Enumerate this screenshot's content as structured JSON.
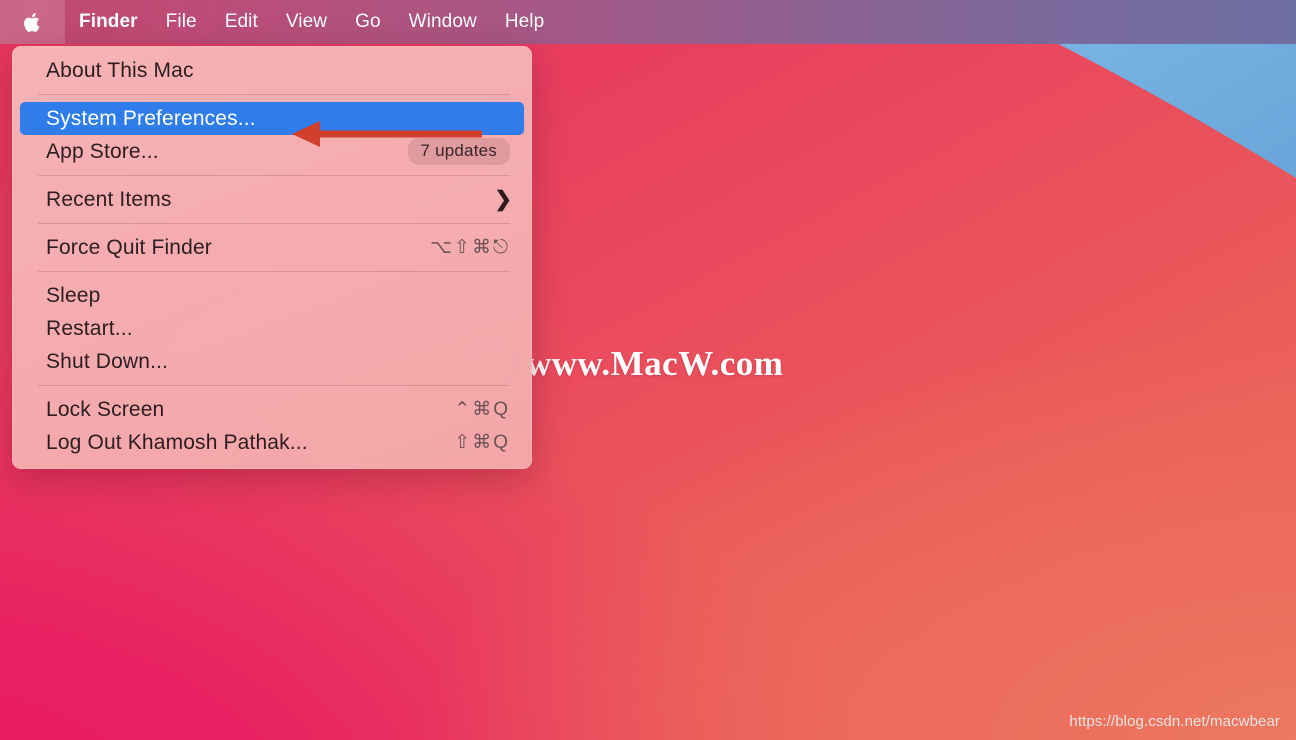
{
  "menubar": {
    "apple_icon": "apple-logo-icon",
    "items": [
      {
        "label": "Finder",
        "bold": true
      },
      {
        "label": "File",
        "bold": false
      },
      {
        "label": "Edit",
        "bold": false
      },
      {
        "label": "View",
        "bold": false
      },
      {
        "label": "Go",
        "bold": false
      },
      {
        "label": "Window",
        "bold": false
      },
      {
        "label": "Help",
        "bold": false
      }
    ]
  },
  "apple_menu": {
    "groups": [
      {
        "rows": [
          {
            "name": "about-this-mac",
            "label": "About This Mac",
            "shortcut": "",
            "badge": "",
            "submenu": false,
            "highlighted": false
          }
        ]
      },
      {
        "rows": [
          {
            "name": "system-preferences",
            "label": "System Preferences...",
            "shortcut": "",
            "badge": "",
            "submenu": false,
            "highlighted": true
          },
          {
            "name": "app-store",
            "label": "App Store...",
            "shortcut": "",
            "badge": "7 updates",
            "submenu": false,
            "highlighted": false
          }
        ]
      },
      {
        "rows": [
          {
            "name": "recent-items",
            "label": "Recent Items",
            "shortcut": "",
            "badge": "",
            "submenu": true,
            "highlighted": false
          }
        ]
      },
      {
        "rows": [
          {
            "name": "force-quit-finder",
            "label": "Force Quit Finder",
            "shortcut": "⌥⇧⌘⎋",
            "badge": "",
            "submenu": false,
            "highlighted": false
          }
        ]
      },
      {
        "rows": [
          {
            "name": "sleep",
            "label": "Sleep",
            "shortcut": "",
            "badge": "",
            "submenu": false,
            "highlighted": false
          },
          {
            "name": "restart",
            "label": "Restart...",
            "shortcut": "",
            "badge": "",
            "submenu": false,
            "highlighted": false
          },
          {
            "name": "shut-down",
            "label": "Shut Down...",
            "shortcut": "",
            "badge": "",
            "submenu": false,
            "highlighted": false
          }
        ]
      },
      {
        "rows": [
          {
            "name": "lock-screen",
            "label": "Lock Screen",
            "shortcut": "⌃⌘Q",
            "badge": "",
            "submenu": false,
            "highlighted": false
          },
          {
            "name": "log-out",
            "label": "Log Out Khamosh Pathak...",
            "shortcut": "⇧⌘Q",
            "badge": "",
            "submenu": false,
            "highlighted": false
          }
        ]
      }
    ]
  },
  "annotation": {
    "type": "left-pointing-arrow",
    "color": "#d0402c"
  },
  "watermark": {
    "text": "www.MacW.com",
    "logo_icon": "macw-monitor-bear-logo-icon"
  },
  "footer": {
    "url": "https://blog.csdn.net/macwbear"
  },
  "colors": {
    "highlight_blue": "#2f7ceb",
    "wallpaper_red": "#ea4f5c",
    "wallpaper_pink": "#e8215f",
    "wallpaper_coral": "#ec6f5b",
    "wallpaper_blue": "#74b2e3",
    "menubar_left": "#c2486f",
    "menubar_right": "#6f6fa2",
    "menu_panel": "#f5b6b6"
  }
}
